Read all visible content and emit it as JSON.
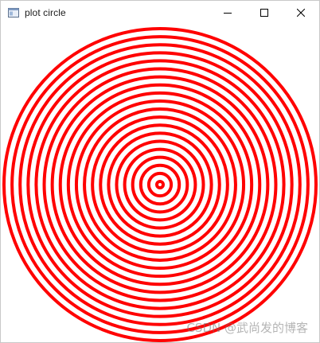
{
  "window": {
    "title": "plot circle",
    "app_icon": "window-app-icon",
    "controls": {
      "minimize_icon": "minimize-icon",
      "maximize_icon": "maximize-icon",
      "close_icon": "close-icon"
    }
  },
  "plot": {
    "ring_color": "#ff0000",
    "background_color": "#ffffff",
    "ring_count": 20
  },
  "watermark": {
    "text": "CSDN @武尚发的博客"
  }
}
